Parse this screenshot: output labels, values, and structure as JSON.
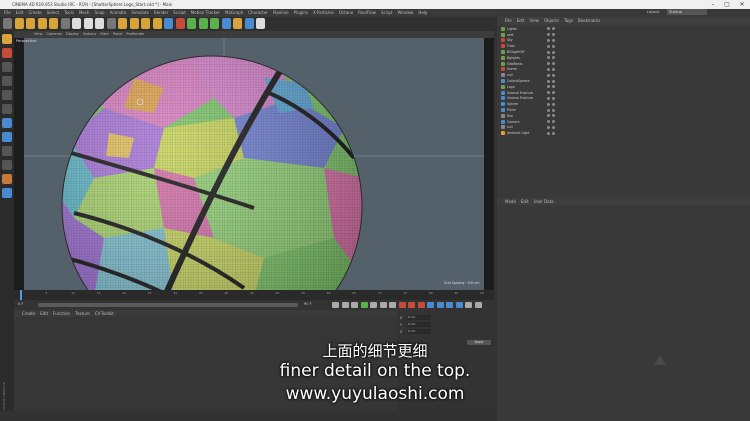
{
  "window": {
    "title": "CINEMA 4D R19.053 Studio (RC - R19) - [ShatterSphere Logo_Start.c4d *] - Main"
  },
  "menubar": [
    "File",
    "Edit",
    "Create",
    "Select",
    "Tools",
    "Mesh",
    "Snap",
    "Animate",
    "Simulate",
    "Render",
    "Sculpt",
    "Motion Tracker",
    "MoGraph",
    "Character",
    "Pipeline",
    "Plugins",
    "X-Particles",
    "Octane",
    "RealFlow",
    "Script",
    "Window",
    "Help"
  ],
  "viewport": {
    "menu": [
      "View",
      "Cameras",
      "Display",
      "Options",
      "Filter",
      "Panel",
      "ProRender"
    ],
    "label": "Perspective",
    "grid_spacing": "Grid Spacing : 100 cm"
  },
  "right_panel": {
    "layout_label": "Layout:",
    "layout_value": "Startup",
    "object_menu": [
      "File",
      "Edit",
      "View",
      "Objects",
      "Tags",
      "Bookmarks"
    ],
    "objects": [
      {
        "name": "Lights",
        "color": "#6fa14a"
      },
      {
        "name": "vert",
        "color": "#6fa14a"
      },
      {
        "name": "Sky",
        "color": "#c84a3a"
      },
      {
        "name": "Floor",
        "color": "#c84a3a"
      },
      {
        "name": "BGLightOff",
        "color": "#6fa14a"
      },
      {
        "name": "Bglights",
        "color": "#6fa14a"
      },
      {
        "name": "SideRects",
        "color": "#6fa14a"
      },
      {
        "name": "Scene",
        "color": "#c84a3a"
      },
      {
        "name": "null",
        "color": "#888888"
      },
      {
        "name": "CalloutSphere",
        "color": "#4a8ad0"
      },
      {
        "name": "Logo",
        "color": "#6fa14a"
      },
      {
        "name": "Voronoi Fracture",
        "color": "#4a8ad0"
      },
      {
        "name": "Voronoi Fracture",
        "color": "#4a8ad0"
      },
      {
        "name": "Sphere",
        "color": "#4a8ad0"
      },
      {
        "name": "Plane",
        "color": "#4a8ad0"
      },
      {
        "name": "Null",
        "color": "#888888"
      },
      {
        "name": "Camera",
        "color": "#4a8ad0"
      },
      {
        "name": "null",
        "color": "#888888"
      },
      {
        "name": "Ambient Light",
        "color": "#e0a030"
      }
    ],
    "attr_menu": [
      "Mode",
      "Edit",
      "User Data"
    ]
  },
  "timeline": {
    "ticks": [
      "0",
      "5",
      "10",
      "15",
      "20",
      "25",
      "30",
      "35",
      "40",
      "45",
      "50",
      "55",
      "60",
      "65",
      "70",
      "75",
      "80",
      "85",
      "90"
    ],
    "frame_start": "0 F",
    "frame_end": "90 F",
    "current": "0 F"
  },
  "material_menu": [
    "Create",
    "Edit",
    "Function",
    "Texture",
    "CV-Toolkit"
  ],
  "coords": {
    "rows": [
      "X",
      "Y",
      "Z"
    ],
    "values": [
      "0 cm",
      "0 cm",
      "0 cm"
    ],
    "apply": "Apply"
  },
  "left_brand": "MAXON CINEMA4D",
  "subtitle": {
    "chinese": "上面的细节更细",
    "english": "finer detail on the top.",
    "url": "www.yuyulaoshi.com"
  }
}
